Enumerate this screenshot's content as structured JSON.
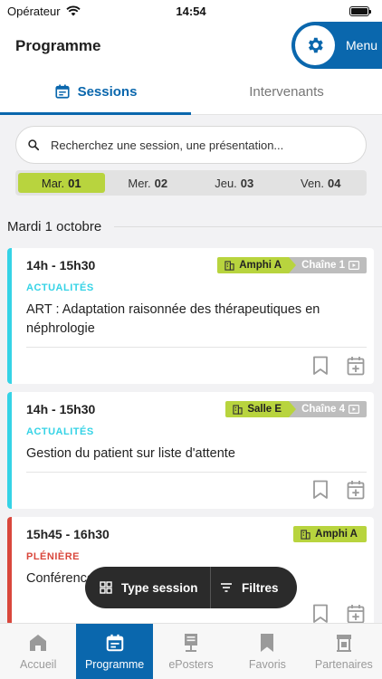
{
  "status": {
    "carrier": "Opérateur",
    "time": "14:54"
  },
  "header": {
    "title": "Programme",
    "menu_label": "Menu"
  },
  "tabs": [
    {
      "label": "Sessions",
      "active": true
    },
    {
      "label": "Intervenants",
      "active": false
    }
  ],
  "search": {
    "placeholder": "Recherchez une session, une présentation..."
  },
  "days": [
    {
      "name": "Mar.",
      "num": "01",
      "active": true
    },
    {
      "name": "Mer.",
      "num": "02",
      "active": false
    },
    {
      "name": "Jeu.",
      "num": "03",
      "active": false
    },
    {
      "name": "Ven.",
      "num": "04",
      "active": false
    }
  ],
  "date_heading": "Mardi 1 octobre",
  "sessions": [
    {
      "time": "14h - 15h30",
      "room": "Amphi A",
      "chain": "Chaîne 1",
      "category": "ACTUALITÉS",
      "category_color": "#35d3e6",
      "title": "ART : Adaptation raisonnée des thérapeutiques en néphrologie"
    },
    {
      "time": "14h - 15h30",
      "room": "Salle E",
      "chain": "Chaîne 4",
      "category": "ACTUALITÉS",
      "category_color": "#35d3e6",
      "title": "Gestion du patient sur liste d'attente"
    },
    {
      "time": "15h45 - 16h30",
      "room": "Amphi A",
      "chain": "",
      "category": "PLÉNIÈRE",
      "category_color": "#d9473c",
      "title": "Conférence"
    }
  ],
  "fab": {
    "type_label": "Type session",
    "filter_label": "Filtres"
  },
  "tabbar": [
    {
      "label": "Accueil",
      "icon": "home-icon",
      "active": false
    },
    {
      "label": "Programme",
      "icon": "calendar-icon",
      "active": true
    },
    {
      "label": "ePosters",
      "icon": "poster-icon",
      "active": false
    },
    {
      "label": "Favoris",
      "icon": "bookmark-icon",
      "active": false
    },
    {
      "label": "Partenaires",
      "icon": "booth-icon",
      "active": false
    }
  ],
  "colors": {
    "brand": "#0a67ad",
    "accent": "#b8d43e"
  }
}
